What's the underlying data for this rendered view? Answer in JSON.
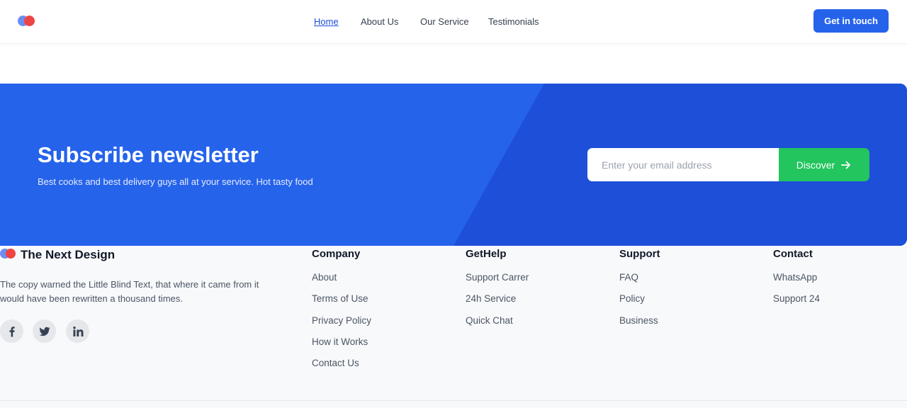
{
  "header": {
    "logo_icon": "two-dots-logo-icon",
    "nav": [
      {
        "label": "Home",
        "active": true
      },
      {
        "label": "About Us",
        "active": false
      },
      {
        "label": "Our Service",
        "active": false
      },
      {
        "label": "Testimonials",
        "active": false
      }
    ],
    "cta_label": "Get in touch"
  },
  "newsletter": {
    "title": "Subscribe newsletter",
    "subtitle": "Best cooks and best delivery guys all at your service. Hot tasty food",
    "email_placeholder": "Enter your email address",
    "email_value": "",
    "button_label": "Discover",
    "button_icon": "arrow-right-icon"
  },
  "footer": {
    "brand": "The Next Design",
    "description": "The copy warned the Little Blind Text, that where it came from it would have been rewritten a thousand times.",
    "social": [
      {
        "icon": "facebook-icon"
      },
      {
        "icon": "twitter-icon"
      },
      {
        "icon": "linkedin-icon"
      }
    ],
    "columns": [
      {
        "title": "Company",
        "links": [
          "About",
          "Terms of Use",
          "Privacy Policy",
          "How it Works",
          "Contact Us"
        ]
      },
      {
        "title": "GetHelp",
        "links": [
          "Support Carrer",
          "24h Service",
          "Quick Chat"
        ]
      },
      {
        "title": "Support",
        "links": [
          "FAQ",
          "Policy",
          "Business"
        ]
      },
      {
        "title": "Contact",
        "links": [
          "WhatsApp",
          "Support 24"
        ]
      }
    ]
  },
  "colors": {
    "primary": "#2563eb",
    "primary_dark": "#1d4ed8",
    "accent_green": "#22c55e",
    "logo_blue": "#6b8ef0",
    "logo_red": "#ef4444",
    "footer_bg": "#f8f9fb"
  }
}
